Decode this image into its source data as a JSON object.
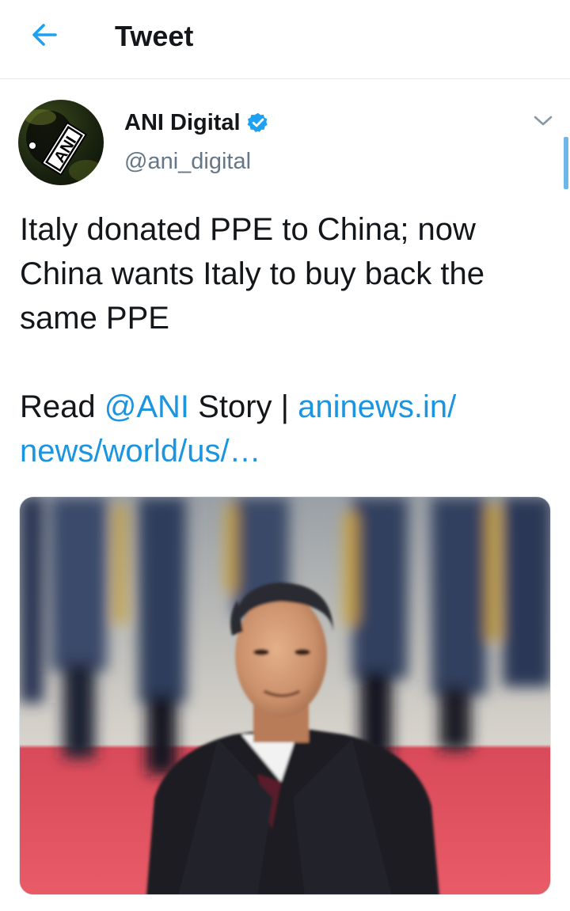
{
  "header": {
    "title": "Tweet",
    "back_icon": "arrow-left-icon"
  },
  "tweet": {
    "author": {
      "name": "ANI Digital",
      "handle": "@ani_digital",
      "verified": true,
      "avatar_text": "ANI"
    },
    "text_lines": [
      "Italy donated PPE to China; now",
      "China wants Italy to buy back the",
      "same PPE"
    ],
    "read_prefix": "Read ",
    "mention": "@ANI",
    "story_text": " Story | ",
    "link_line1": "aninews.in/",
    "link_line2": "news/world/us/…",
    "media_alt": "photo"
  },
  "colors": {
    "accent": "#1da1f2",
    "link": "#1b95e0",
    "text": "#14171a",
    "secondary": "#657786",
    "divider": "#e1e8ed"
  }
}
